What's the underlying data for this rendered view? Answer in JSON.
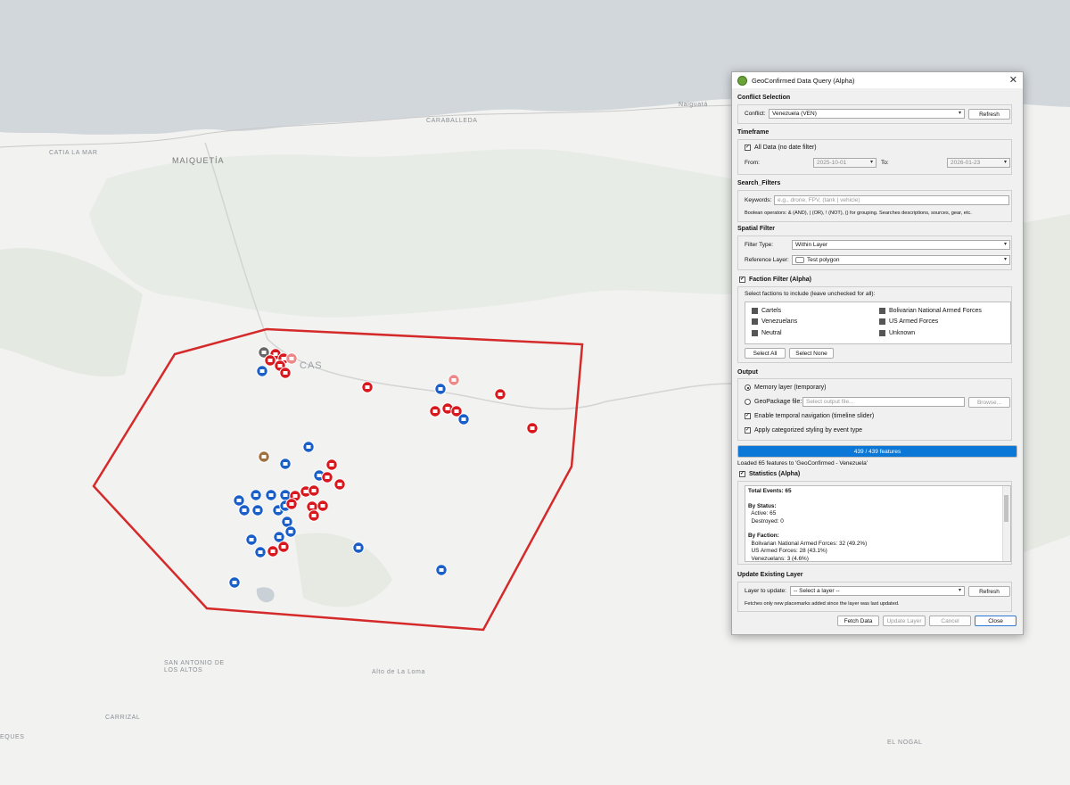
{
  "map": {
    "places": [
      "CARABALLEDA",
      "CATIA LA MAR",
      "MAIQUETÍA",
      "CAS",
      "Naiguatá",
      "SAN ANTONIO DE",
      "LOS ALTOS",
      "Alto de La Loma",
      "CARRIZAL",
      "EQUES",
      "EL NOGAL"
    ],
    "colors": {
      "sea": "#d2d7dc",
      "land": "#f2f2f1",
      "green": "#e7ebe5",
      "polygon": "#d42a2a",
      "marker_red": "#d9181e",
      "marker_blue": "#1a5fc8"
    }
  },
  "dialog": {
    "title": "GeoConfirmed Data Query (Alpha)",
    "close_glyph": "✕",
    "conflict": {
      "heading": "Conflict Selection",
      "label": "Conflict:",
      "value": "Venezuela (VEN)",
      "refresh": "Refresh"
    },
    "timeframe": {
      "heading": "Timeframe",
      "all_data": "All Data (no date filter)",
      "from_label": "From:",
      "from": "2025-10-01",
      "to_label": "To:",
      "to": "2026-01-23"
    },
    "search": {
      "heading": "Search_Filters",
      "keywords_label": "Keywords:",
      "placeholder": "e.g., drone, FPV, (tank | vehicle)",
      "help": "Boolean operators: & (AND), | (OR), ! (NOT), () for grouping. Searches descriptions, sources, gear, etc."
    },
    "spatial": {
      "heading": "Spatial Filter",
      "type_label": "Filter Type:",
      "type": "Within Layer",
      "ref_label": "Reference Layer:",
      "ref": "Test polygon"
    },
    "faction": {
      "heading": "Faction Filter (Alpha)",
      "hint": "Select factions to include (leave unchecked for all):",
      "items": [
        "Cartels",
        "Bolivarian National Armed Forces",
        "Venezuelans",
        "US Armed Forces",
        "Neutral",
        "Unknown"
      ],
      "select_all": "Select All",
      "select_none": "Select None"
    },
    "output": {
      "heading": "Output",
      "memory": "Memory layer (temporary)",
      "gpkg": "GeoPackage file:",
      "gpkg_placeholder": "Select output file...",
      "browse": "Browse...",
      "temporal": "Enable temporal navigation (timeline slider)",
      "styling": "Apply categorized styling by event type"
    },
    "progress": {
      "text": "439 / 439 features",
      "value": 1.0
    },
    "loaded": "Loaded 65 features to 'GeoConfirmed - Venezuela'",
    "stats": {
      "heading": "Statistics (Alpha)",
      "lines": [
        "Total Events: 65",
        "",
        "By Status:",
        "  Active: 65",
        "  Destroyed: 0",
        "",
        "By Faction:",
        "  Bolivarian National Armed Forces: 32 (49.2%)",
        "  US Armed Forces: 28 (43.1%)",
        "  Venezuelans: 3 (4.6%)"
      ]
    },
    "update": {
      "heading": "Update Existing Layer",
      "label": "Layer to update:",
      "value": "-- Select a layer --",
      "refresh": "Refresh",
      "help": "Fetches only new placemarks added since the layer was last updated."
    },
    "footer": {
      "fetch": "Fetch Data",
      "update": "Update Layer",
      "cancel": "Cancel",
      "close": "Close"
    }
  }
}
